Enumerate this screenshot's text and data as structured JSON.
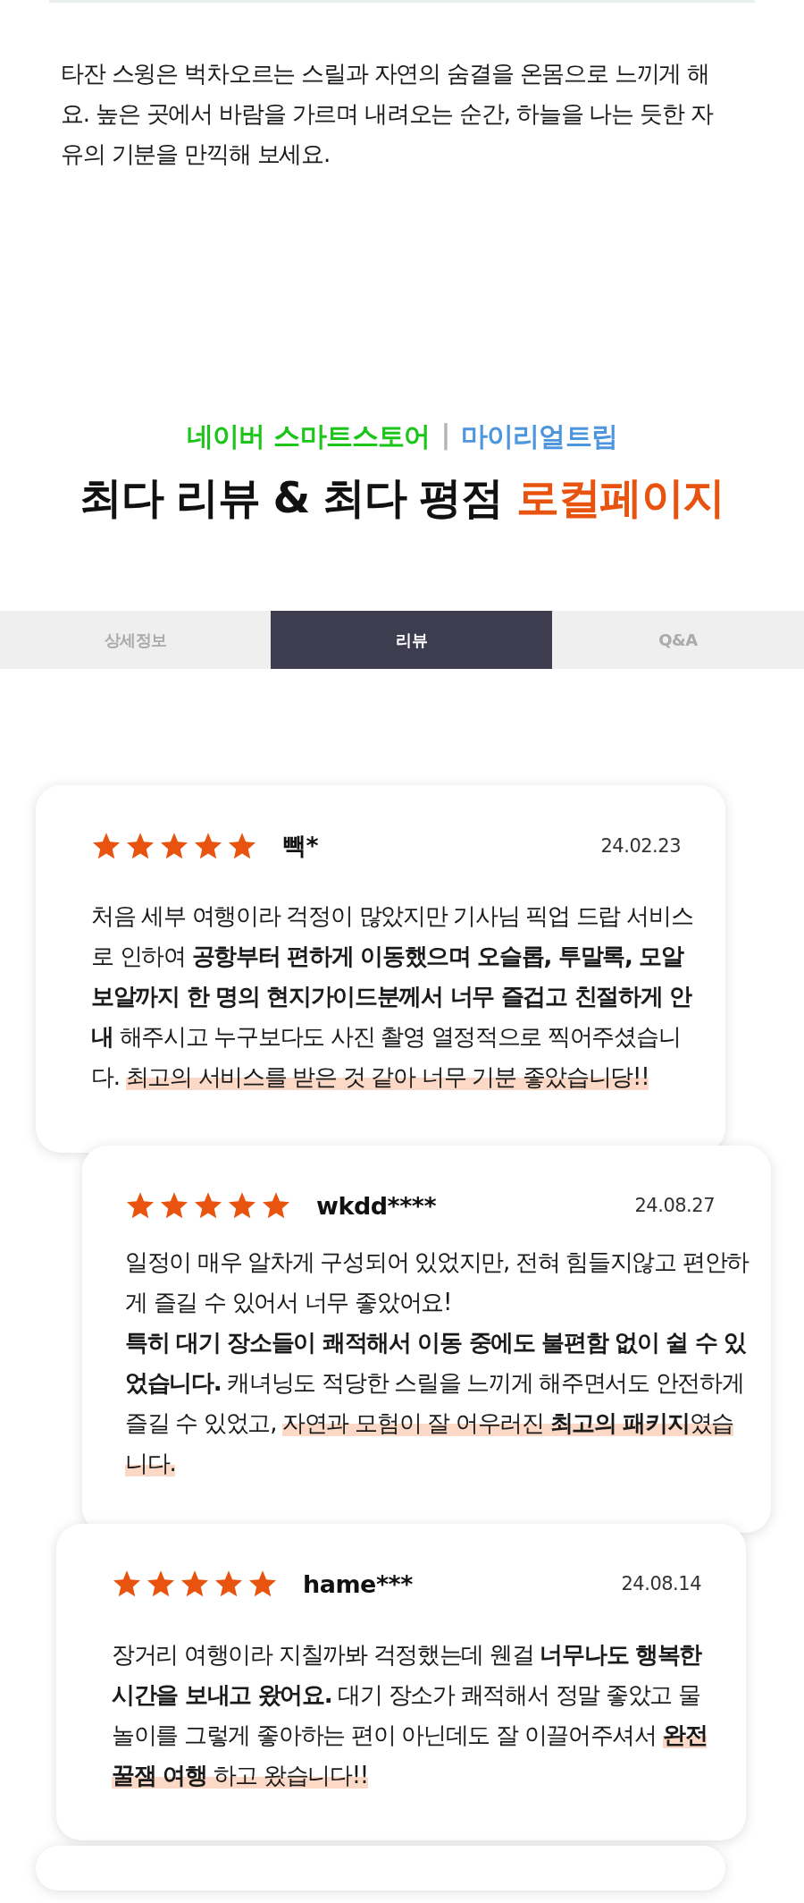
{
  "intro": {
    "text": "타잔 스윙은 벅차오르는 스릴과 자연의 숨결을 온몸으로 느끼게 해요. 높은 곳에서 바람을 가르며 내려오는 순간, 하늘을 나는 듯한 자유의 기분을 만끽해 보세요."
  },
  "heading": {
    "brand_line": [
      {
        "text": "네이버 스마트스토어",
        "color": "#1dc41a"
      },
      {
        "text": "|",
        "color": "#b4b4b4"
      },
      {
        "text": "마이리얼트립",
        "color": "#4d95dc"
      }
    ],
    "title": [
      {
        "text": "최다 리뷰 & 최다 평점",
        "color": "#111111"
      },
      {
        "text": "로컬페이지",
        "color": "#e8540f"
      }
    ]
  },
  "tabs": [
    {
      "label": "상세정보",
      "selected": false
    },
    {
      "label": "리뷰",
      "selected": true
    },
    {
      "label": "Q&A",
      "selected": false
    }
  ],
  "reviews": [
    {
      "stars": 5,
      "author": "빽*",
      "date": "24.02.23",
      "body": [
        {
          "text": "처음 세부 여행이라 걱정이 많았지만 기사님 픽업 드랍 서비스로 인하여 ",
          "bold": false,
          "highlight": false
        },
        {
          "text": "공항부터 편하게 이동했으며 오슬롭, 투말록, 모알보알까지 한 명의 현지가이드분께서 너무 즐겁고 친절하게 안내",
          "bold": true,
          "highlight": false
        },
        {
          "text": " 해주시고 누구보다도 사진 촬영 열정적으로 찍어주셨습니다. ",
          "bold": false,
          "highlight": false
        },
        {
          "text": "최고의 서비스를 받은 것 같아 너무 기분 좋았습니당!!",
          "bold": false,
          "highlight": true
        }
      ]
    },
    {
      "stars": 5,
      "author": "wkdd****",
      "date": "24.08.27",
      "body": [
        {
          "text": "일정이 매우 알차게 구성되어 있었지만, 전혀 힘들지않고 편안하게 즐길 수 있어서 너무 좋았어요!\n",
          "bold": false,
          "highlight": false
        },
        {
          "text": "특히 대기 장소들이 쾌적해서 이동 중에도 불편함 없이 쉴 수 있었습니다.",
          "bold": true,
          "highlight": false
        },
        {
          "text": " 캐녀닝도 적당한 스릴을 느끼게 해주면서도 안전하게 즐길 수 있었고, ",
          "bold": false,
          "highlight": false
        },
        {
          "text": "자연과 모험이 잘 어우러진 ",
          "bold": false,
          "highlight": true
        },
        {
          "text": "최고의 패키지",
          "bold": true,
          "highlight": true
        },
        {
          "text": "였습니다.",
          "bold": false,
          "highlight": true
        }
      ]
    },
    {
      "stars": 5,
      "author": "hame***",
      "date": "24.08.14",
      "body": [
        {
          "text": "장거리 여행이라 지칠까봐 걱정했는데 웬걸 ",
          "bold": false,
          "highlight": false
        },
        {
          "text": "너무나도 행복한 시간을 보내고 왔어요.",
          "bold": true,
          "highlight": false
        },
        {
          "text": " 대기 장소가 쾌적해서 정말 좋았고 물놀이를 그렇게 좋아하는 편이 아닌데도 잘 이끌어주셔서 ",
          "bold": false,
          "highlight": false
        },
        {
          "text": "완전 꿀잼 여행",
          "bold": true,
          "highlight": true
        },
        {
          "text": " 하고 왔습니다!!",
          "bold": false,
          "highlight": true
        }
      ]
    }
  ]
}
